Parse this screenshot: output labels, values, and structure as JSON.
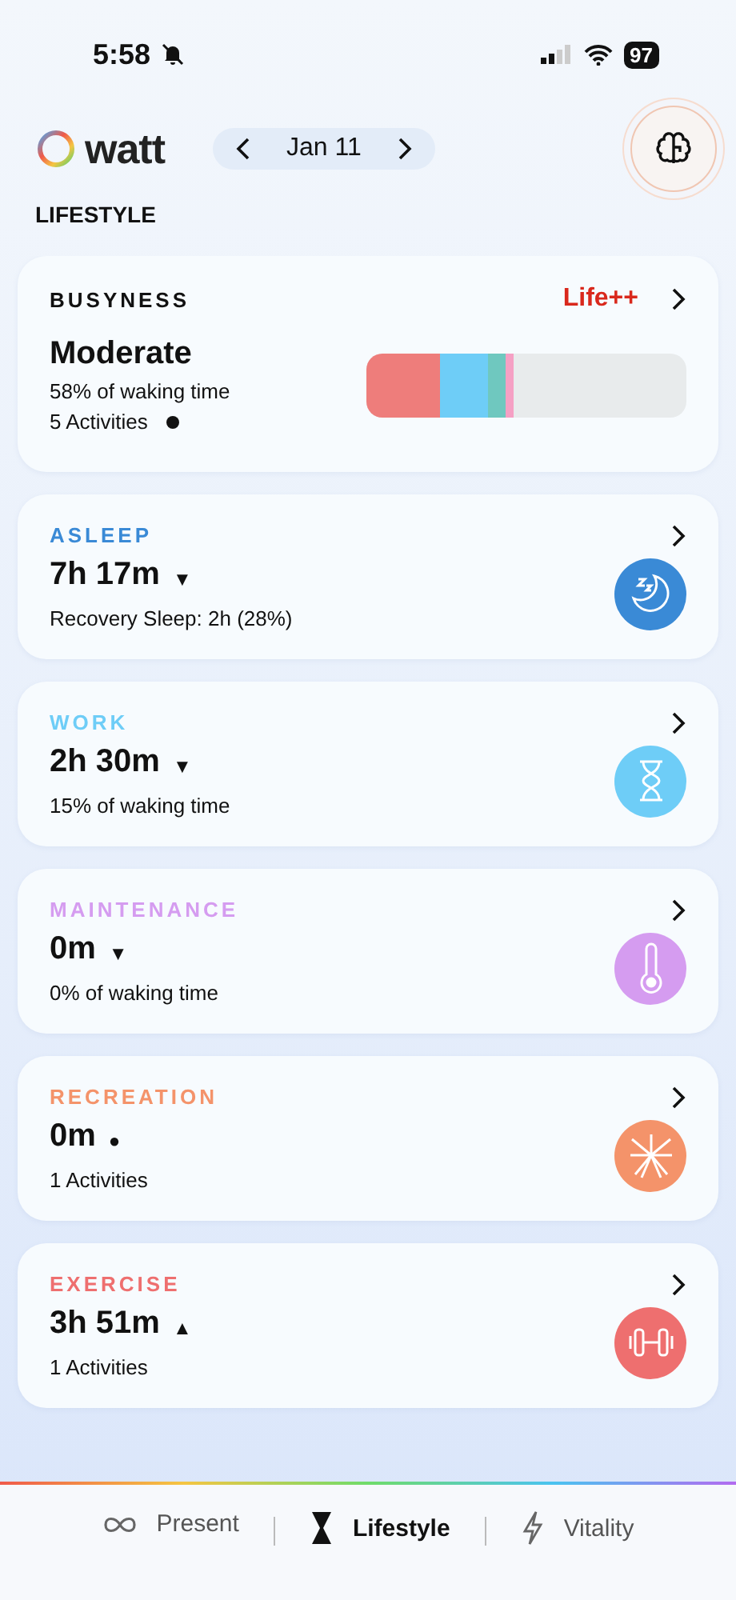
{
  "status_bar": {
    "time": "5:58",
    "battery": "97"
  },
  "header": {
    "logo": "watt",
    "date": "Jan 11"
  },
  "section_title": "LIFESTYLE",
  "busyness": {
    "title": "BUSYNESS",
    "link": "Life++",
    "value": "Moderate",
    "share": "58% of waking time",
    "activities": "5 Activities",
    "segments": [
      {
        "color": "#ee7d7b"
      },
      {
        "color": "#6ecdf7"
      },
      {
        "color": "#6fc8bf"
      },
      {
        "color": "#f5a0c4"
      }
    ]
  },
  "cards": [
    {
      "kind": "sleep",
      "title": "ASLEEP",
      "color": "#3a8ad6",
      "value": "7h 17m",
      "trend": "▼",
      "detail": "Recovery Sleep: 2h (28%)"
    },
    {
      "kind": "work",
      "title": "WORK",
      "color": "#6ecdf7",
      "value": "2h 30m",
      "trend": "▼",
      "detail": "15% of waking time"
    },
    {
      "kind": "maintenance",
      "title": "MAINTENANCE",
      "color": "#d59cf0",
      "value": "0m",
      "trend": "▼",
      "detail": "0% of waking time"
    },
    {
      "kind": "recreation",
      "title": "RECREATION",
      "color": "#f4936a",
      "value": "0m",
      "trend": "●",
      "detail": "1 Activities"
    },
    {
      "kind": "exercise",
      "title": "EXERCISE",
      "color": "#ee6f6f",
      "value": "3h 51m",
      "trend": "▲",
      "detail": "1 Activities"
    }
  ],
  "tabs": [
    {
      "label": "Present",
      "selected": false
    },
    {
      "label": "Lifestyle",
      "selected": true
    },
    {
      "label": "Vitality",
      "selected": false
    }
  ]
}
